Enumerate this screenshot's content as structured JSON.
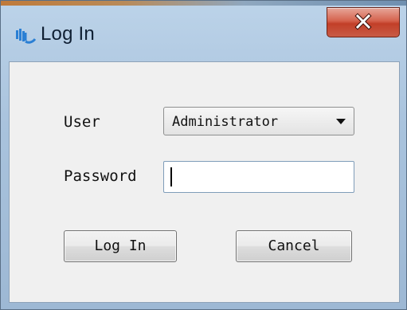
{
  "window": {
    "title": "Log In",
    "icon": "app-logo-icon",
    "accent_colors": {
      "title_bar": "#a9c3dd",
      "close_button": "#c85b46"
    }
  },
  "form": {
    "user_label": "User",
    "user_value": "Administrator",
    "password_label": "Password",
    "password_value": ""
  },
  "buttons": {
    "login_label": "Log In",
    "cancel_label": "Cancel"
  }
}
